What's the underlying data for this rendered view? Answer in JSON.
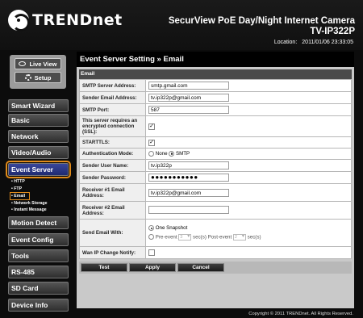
{
  "header": {
    "brand": "TRENDnet",
    "camera_title": "SecurView PoE Day/Night Internet Camera",
    "model": "TV-IP322P",
    "location_label": "Location:",
    "datetime": "2011/01/06 23:33:05"
  },
  "panel": {
    "live_view": "Live View",
    "setup": "Setup"
  },
  "nav": {
    "smart_wizard": "Smart Wizard",
    "basic": "Basic",
    "network": "Network",
    "video_audio": "Video/Audio",
    "event_server": "Event Server",
    "sub": [
      "• HTTP",
      "• FTP",
      "• Email",
      "• Network Storage",
      "• Instant Message"
    ],
    "motion_detect": "Motion Detect",
    "event_config": "Event Config",
    "tools": "Tools",
    "rs485": "RS-485",
    "sd_card": "SD Card",
    "device_info": "Device Info"
  },
  "page": {
    "title": "Event Server Setting » Email",
    "section": "Email"
  },
  "form": {
    "smtp_server": {
      "label": "SMTP Server Address:",
      "value": "smtp.gmail.com"
    },
    "sender_email": {
      "label": "Sender Email Address:",
      "value": "tv.ip322p@gmail.com"
    },
    "smtp_port": {
      "label": "SMTP Port:",
      "value": "587"
    },
    "ssl": {
      "label": "This server requires an encrypted connection (SSL):",
      "checked": "✓"
    },
    "starttls": {
      "label": "STARTTLS:",
      "checked": "✓"
    },
    "auth_mode": {
      "label": "Authentication Mode:",
      "none": "None",
      "smtp": "SMTP",
      "selected": "SMTP"
    },
    "sender_user": {
      "label": "Sender User Name:",
      "value": "tv.ip322p"
    },
    "sender_password": {
      "label": "Sender Password:",
      "value": "●●●●●●●●●●●"
    },
    "receiver1": {
      "label": "Receiver #1 Email Address:",
      "value": "tv.ip322p@gmail.com"
    },
    "receiver2": {
      "label": "Receiver #2 Email Address:",
      "value": ""
    },
    "send_with": {
      "label": "Send Email With:",
      "one_snapshot": "One Snapshot",
      "pre_event": "Pre-event",
      "pre_value": "3",
      "sec1": "sec(s)",
      "post_event": "Post-event",
      "post_value": "2",
      "sec2": "sec(s)",
      "selected": "One Snapshot"
    },
    "wan_ip": {
      "label": "Wan IP Change Notify:",
      "checked": ""
    }
  },
  "buttons": {
    "test": "Test",
    "apply": "Apply",
    "cancel": "Cancel"
  },
  "footer": "Copyright © 2011 TRENDnet. All Rights Reserved.",
  "colors": {
    "highlight": "#e08a1a",
    "selected_nav": "#2b3785"
  }
}
